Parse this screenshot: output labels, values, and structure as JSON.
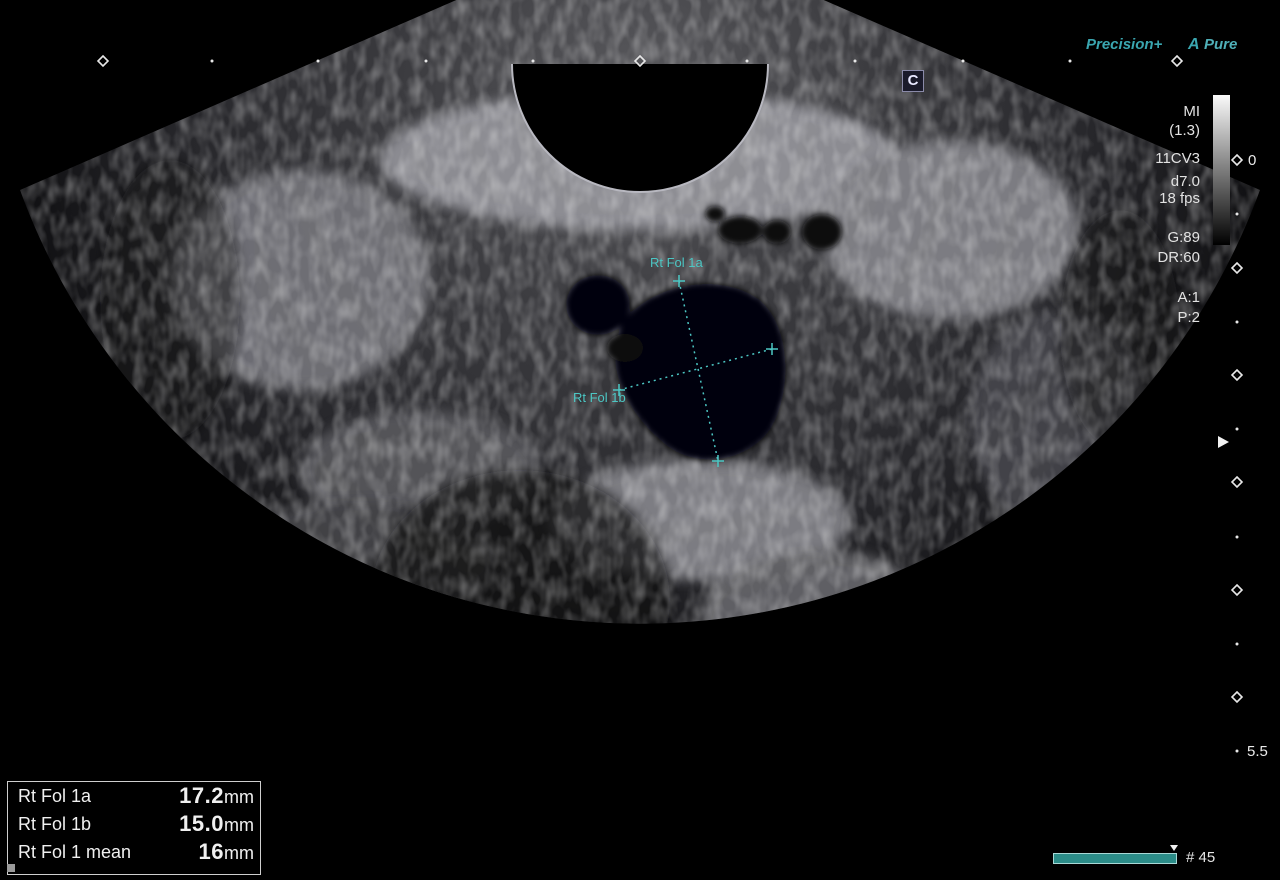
{
  "brand": {
    "precision": "Precision+",
    "pure_a": "A",
    "pure": "Pure"
  },
  "badge": {
    "label": "C"
  },
  "params": {
    "mi_label": "MI",
    "mi_value": "(1.3)",
    "probe": "11CV3",
    "depth": "d7.0",
    "fps": "18 fps",
    "gain": "G:89",
    "dynamic_range": "DR:60",
    "a": "A:1",
    "p": "P:2"
  },
  "depth_scale": {
    "top": "0",
    "bottom": "5.5"
  },
  "calipers": {
    "label_a": "Rt Fol 1a",
    "label_b": "Rt Fol 1b"
  },
  "measurements": [
    {
      "label": "Rt Fol 1a",
      "value": "17.2",
      "unit": "mm"
    },
    {
      "label": "Rt Fol 1b",
      "value": "15.0",
      "unit": "mm"
    },
    {
      "label": "Rt Fol 1 mean",
      "value": "16",
      "unit": "mm"
    }
  ],
  "cine": {
    "frame": "# 45"
  },
  "colors": {
    "caliper": "#4cc7c4",
    "brand": "#3aa6b0",
    "cine": "#2b8c88"
  },
  "icons": [
    "focus-marker-icon",
    "cine-marker-icon"
  ]
}
